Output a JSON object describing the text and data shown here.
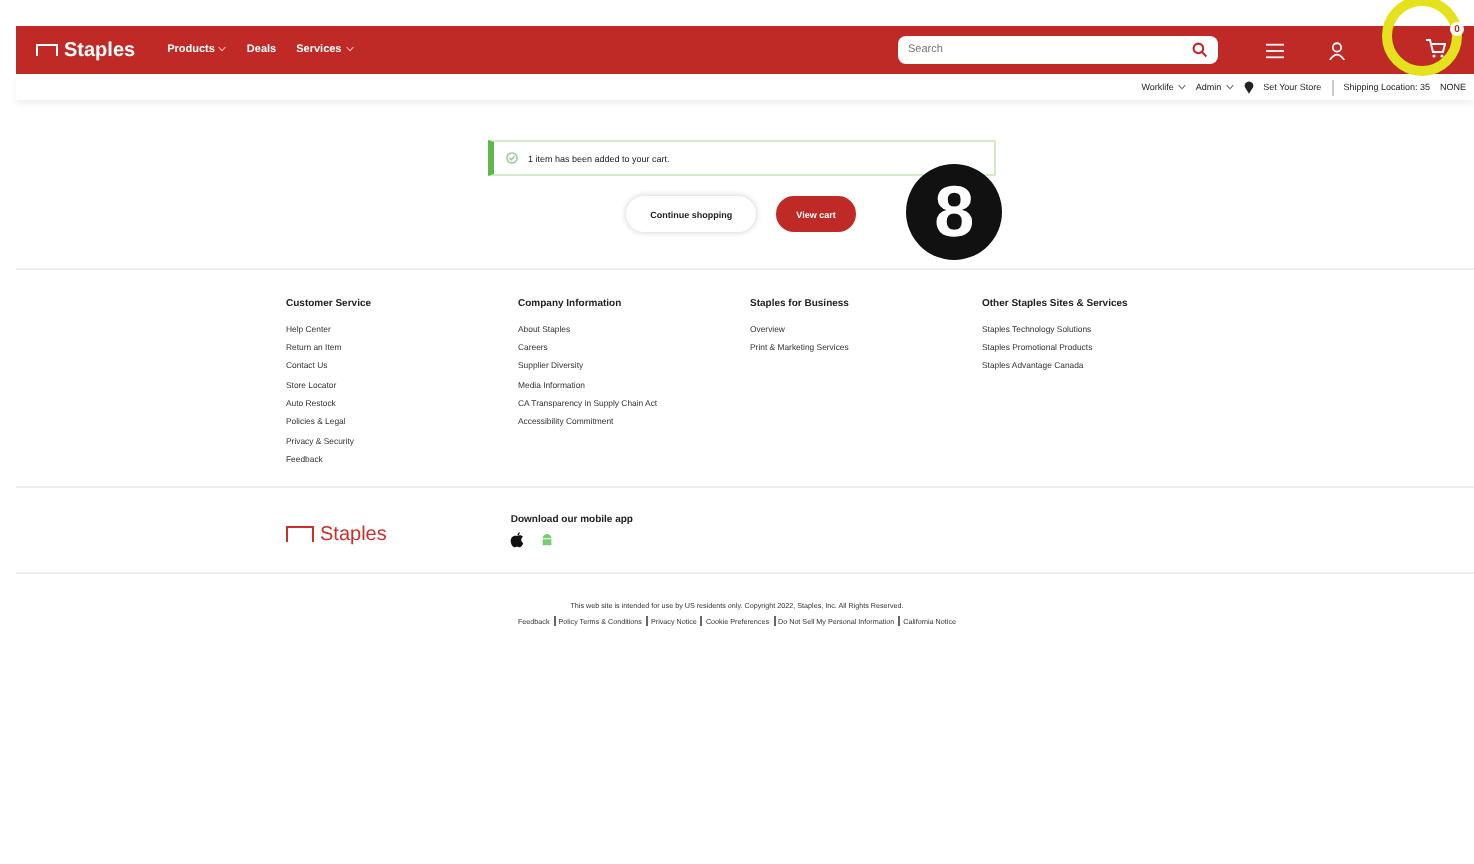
{
  "header": {
    "logo": "Staples",
    "nav": [
      {
        "label": "Products",
        "dropdown": true
      },
      {
        "label": "Deals",
        "dropdown": false
      },
      {
        "label": "Services",
        "dropdown": true
      }
    ],
    "search": {
      "placeholder": "Search"
    },
    "cart_count": "0"
  },
  "subbar": {
    "items": [
      {
        "label": "Worklife",
        "dropdown": true
      },
      {
        "label": "Admin",
        "dropdown": true
      }
    ],
    "store": "Set Your Store",
    "shipping": "Shipping Location: 35",
    "shipping_value": "NONE"
  },
  "notice": {
    "text": "1 item has been added to your cart."
  },
  "buttons": [
    {
      "label": "Continue shopping",
      "kind": "secondary"
    },
    {
      "label": "View cart",
      "kind": "primary"
    }
  ],
  "step_badge": "8",
  "footer": {
    "columns": [
      {
        "title": "Customer Service",
        "links": [
          "Help Center",
          "Return an Item",
          "Contact Us",
          "Store Locator",
          "Auto Restock",
          "Policies & Legal",
          "Privacy & Security",
          "Feedback"
        ]
      },
      {
        "title": "Company Information",
        "links": [
          "About Staples",
          "Careers",
          "Supplier Diversity",
          "Media Information",
          "CA Transparency in Supply Chain Act",
          "Accessibility Commitment"
        ]
      },
      {
        "title": "Staples for Business",
        "links": [
          "Overview",
          "Print & Marketing Services"
        ]
      },
      {
        "title": "Other Staples Sites & Services",
        "links": [
          "Staples Technology Solutions",
          "Staples Promotional Products",
          "Staples Advantage Canada"
        ]
      }
    ],
    "logo": "Staples",
    "app_title": "Download our mobile app",
    "legal": "This web site is intended for use by US residents only. Copyright 2022, Staples, Inc. All Rights Reserved.",
    "legal_links": [
      "Feedback",
      "Policy Terms & Conditions",
      "Privacy Notice",
      "Cookie Preferences",
      "Do Not Sell My Personal Information",
      "California Notice"
    ]
  }
}
